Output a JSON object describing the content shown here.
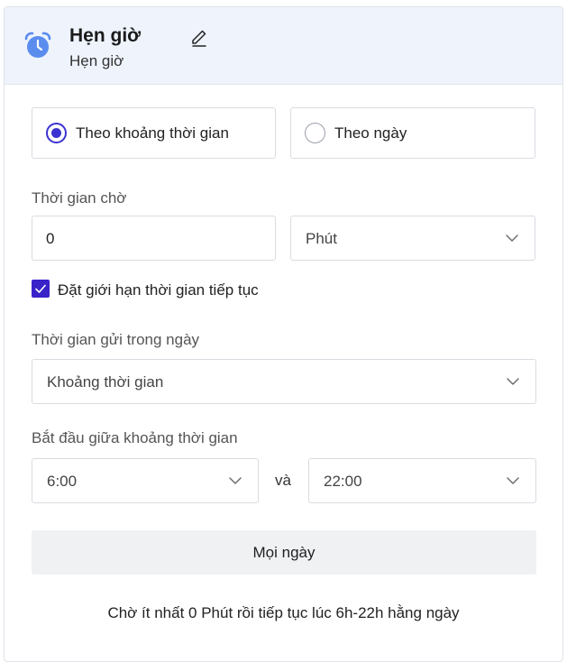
{
  "header": {
    "title": "Hẹn giờ",
    "subtitle": "Hẹn giờ",
    "icon": "alarm-clock-icon",
    "edit_icon": "pencil-icon"
  },
  "mode": {
    "options": [
      {
        "label": "Theo khoảng thời gian",
        "selected": true
      },
      {
        "label": "Theo ngày",
        "selected": false
      }
    ]
  },
  "wait": {
    "label": "Thời gian chờ",
    "value": "0",
    "unit": "Phút"
  },
  "limit": {
    "label": "Đặt giới hạn thời gian tiếp tục",
    "checked": true
  },
  "send_time": {
    "label": "Thời gian gửi trong ngày",
    "value": "Khoảng thời gian"
  },
  "range": {
    "label": "Bắt đầu giữa khoảng thời gian",
    "start": "6:00",
    "and": "và",
    "end": "22:00"
  },
  "days_button": "Mọi ngày",
  "summary": "Chờ ít nhất 0 Phút rồi tiếp tục lúc 6h-22h hằng ngày",
  "colors": {
    "accent": "#3a33d1",
    "header_bg": "#eef3fc",
    "icon_blue": "#5b8def"
  }
}
